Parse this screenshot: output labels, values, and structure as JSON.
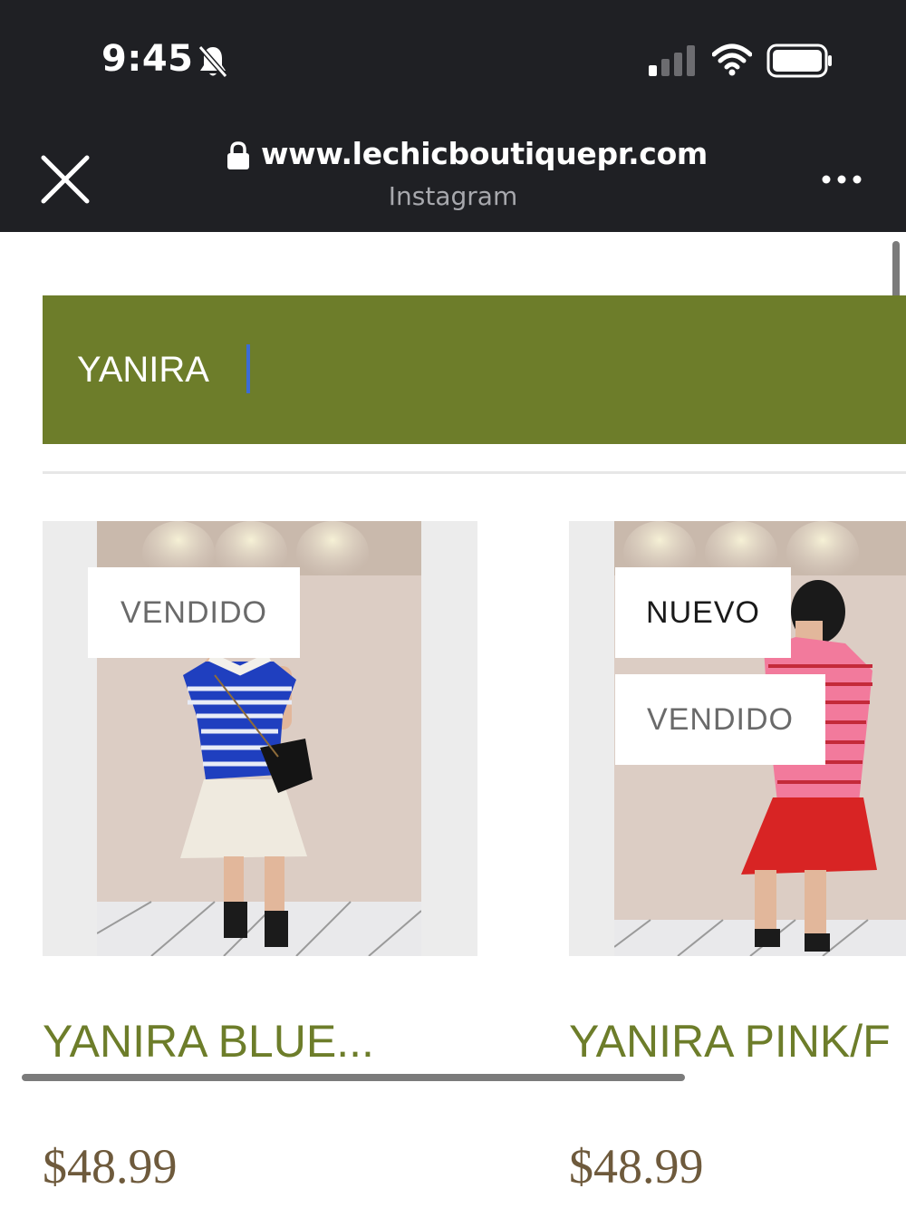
{
  "status_bar": {
    "time": "9:45",
    "icons": [
      "bell-slash-icon",
      "signal-icon",
      "wifi-icon",
      "battery-icon"
    ]
  },
  "browser": {
    "url": "www.lechicboutiquepr.com",
    "source": "Instagram",
    "icons": [
      "close-icon",
      "lock-icon",
      "more-icon"
    ]
  },
  "search": {
    "value": "YANIRA",
    "background": "#6d7d2a"
  },
  "products": [
    {
      "title": "YANIRA BLUE...",
      "price": "$48.99",
      "badges": [
        "VENDIDO"
      ],
      "photo": "woman in blue striped polo and white skirt"
    },
    {
      "title": "YANIRA PINK/F",
      "price": "$48.99",
      "badges": [
        "NUEVO",
        "VENDIDO"
      ],
      "photo": "woman in pink striped polo and red skirt"
    }
  ],
  "colors": {
    "accent_green": "#6d7d2a",
    "price_brown": "#6e5a3c",
    "chrome_bg": "#1f2024"
  }
}
